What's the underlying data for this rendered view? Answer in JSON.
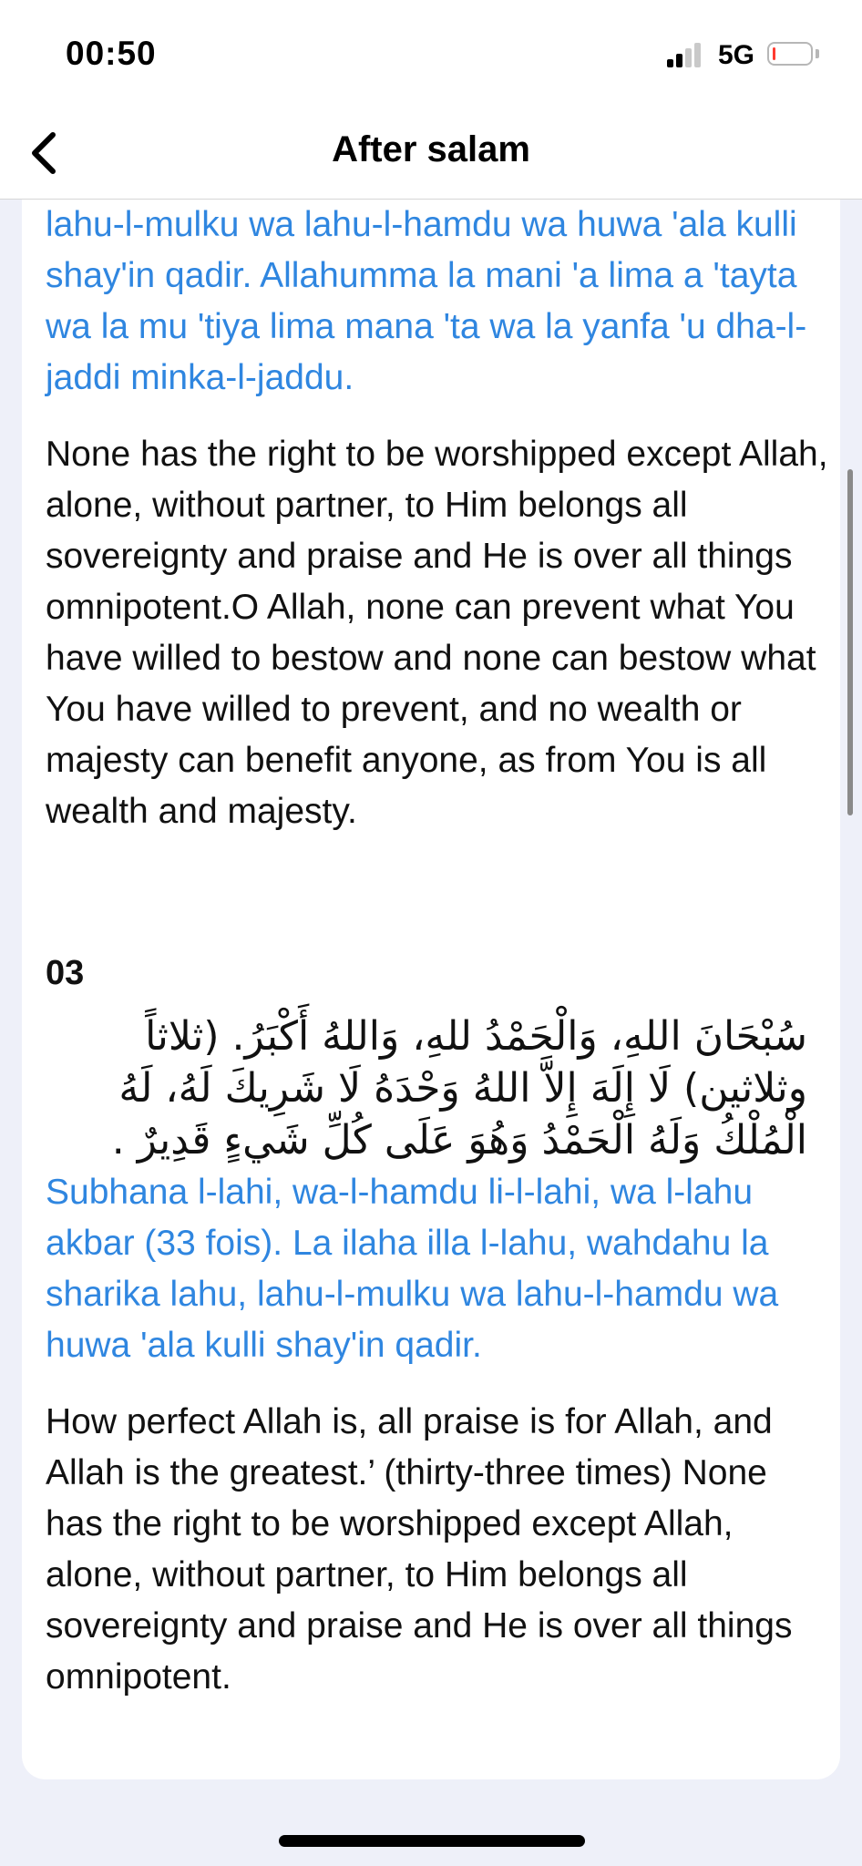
{
  "status_bar": {
    "time": "00:50",
    "network": "5G",
    "battery_level": 0.08,
    "battery_color": "#ff3b30"
  },
  "nav": {
    "title": "After salam",
    "back_icon": "chevron-left-icon"
  },
  "cards": [
    {
      "number": "",
      "transliteration": "lahu-l-mulku wa lahu-l-hamdu wa huwa 'ala kulli shay'in qadir. Allahumma la mani 'a lima a 'tayta wa la mu 'tiya lima mana 'ta wa la yanfa 'u dha-l-jaddi minka-l-jaddu.",
      "translation": "None has the right to be worshipped except Allah, alone, without partner, to Him belongs all sovereignty and praise and He is over all things omnipotent.O Allah, none can prevent what You have willed to bestow and none can bestow what You have willed to prevent, and no wealth or majesty can benefit anyone, as from You is all wealth and majesty."
    },
    {
      "number": "03",
      "arabic": "سُبْحَانَ اللهِ، وَالْحَمْدُ للهِ، وَاللهُ أَكْبَرُ. (ثلاثاً وثلاثين) لَا إِلَهَ إِلاَّ اللهُ وَحْدَهُ لَا شَرِيكَ لَهُ، لَهُ الْمُلْكُ وَلَهُ الْحَمْدُ وَهُوَ عَلَى كُلِّ شَيءٍ قَدِيرٌ .",
      "transliteration": "Subhana l-lahi, wa-l-hamdu li-l-lahi, wa l-lahu akbar (33 fois). La ilaha illa l-lahu, wahdahu la sharika lahu, lahu-l-mulku wa lahu-l-hamdu wa huwa 'ala kulli shay'in qadir.",
      "translation": "How perfect Allah is, all praise is for Allah, and Allah is the greatest.’ (thirty-three times) None has the right to be worshipped except Allah, alone, without partner, to Him belongs all sovereignty and praise and He is over all things omnipotent."
    }
  ],
  "colors": {
    "accent": "#2f86e0",
    "background": "#eef0f9",
    "card": "#ffffff"
  }
}
